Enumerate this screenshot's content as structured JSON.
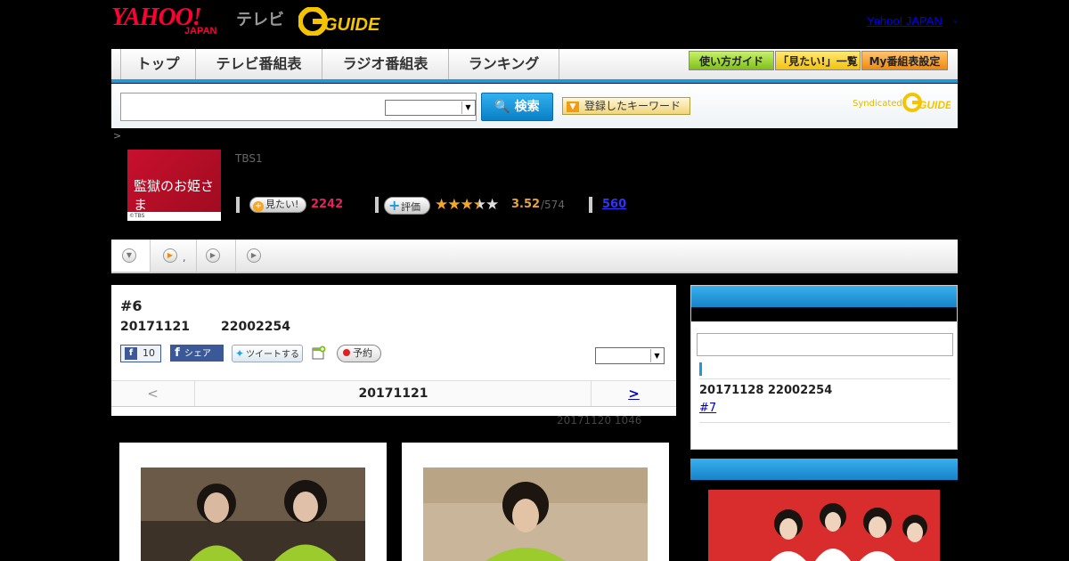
{
  "header": {
    "logo_yahoo": "YAHOO!",
    "logo_japan": "JAPAN",
    "logo_tv": "テレビ",
    "logo_gguide": "G GUIDE",
    "top_link": "Yahoo! JAPAN",
    "top_link_suffix": "."
  },
  "nav": {
    "tabs": [
      {
        "label": "トップ"
      },
      {
        "label": "テレビ番組表"
      },
      {
        "label": "ラジオ番組表"
      },
      {
        "label": "ランキング"
      }
    ],
    "guide_btn": "使い方ガイド",
    "mitai_list_btn": "「見たい!」一覧",
    "my_schedule_btn": "My番組表設定"
  },
  "search": {
    "placeholder": "",
    "select_value": "",
    "search_btn": "検索",
    "keyword_btn": "登録したキーワード",
    "syndicated": "Syndicated",
    "syn_logo": "G GUIDE"
  },
  "breadcrumb": ">",
  "program": {
    "thumb_title": "監獄のお姫さま",
    "thumb_credit": "©TBS",
    "channel": "TBS1",
    "mitai_btn": "見たい!",
    "mitai_count": "2242",
    "rate_btn": "評価",
    "rating": "3.52",
    "rating_stars": 3.5,
    "rating_count": "/574",
    "review_count": "560"
  },
  "tabs": {
    "dot": ","
  },
  "episode": {
    "title": "#6",
    "date": "20171121",
    "time": "22002254",
    "fb_count": "10",
    "fb_share": "シェア",
    "tweet": "ツイートする",
    "record_btn": "予約",
    "select_value": "",
    "prev": "<",
    "current": "20171121",
    "next": ">",
    "update_note": "20171120  1046"
  },
  "sidebar": {
    "next_date": "20171128  22002254",
    "next_ep": "#7"
  },
  "colors": {
    "accent_blue": "#1e9ad6",
    "yahoo_red": "#ff0033",
    "mitai_pink": "#e0245e",
    "star": "#f5a623"
  }
}
